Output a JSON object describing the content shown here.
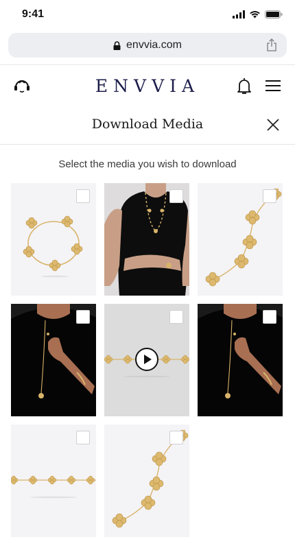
{
  "status_bar": {
    "time": "9:41"
  },
  "browser": {
    "url": "envvia.com"
  },
  "header": {
    "logo": "ENVVIA"
  },
  "modal": {
    "title": "Download Media",
    "instruction": "Select the media you wish to download"
  },
  "media": [
    {
      "kind": "bracelet-product",
      "selected": false
    },
    {
      "kind": "model-necklace-photo",
      "selected": false
    },
    {
      "kind": "necklace-closeup",
      "selected": false
    },
    {
      "kind": "model-hand-photo",
      "selected": false
    },
    {
      "kind": "video",
      "selected": false
    },
    {
      "kind": "model-hand-photo",
      "selected": false
    },
    {
      "kind": "bracelet-flat",
      "selected": false
    },
    {
      "kind": "necklace-closeup",
      "selected": false
    }
  ],
  "colors": {
    "gold": "#d8b46a",
    "tile_bg": "#f4f3f6",
    "brand": "#1c1c4a"
  }
}
